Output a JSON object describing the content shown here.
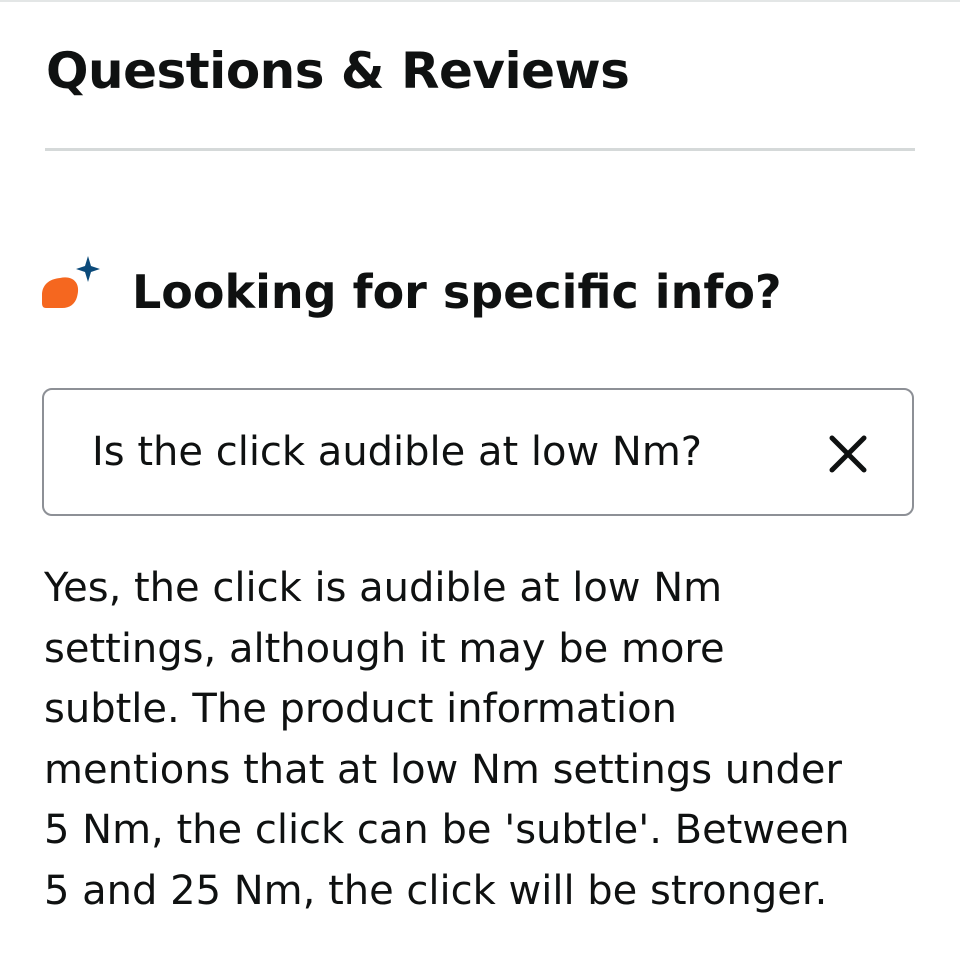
{
  "section": {
    "title": "Questions & Reviews"
  },
  "ai_search": {
    "icon": "ai-sparkle-chat-icon",
    "heading": "Looking for specific info?",
    "query": "Is the click audible at low Nm?",
    "clear_icon": "close-icon",
    "answer": "Yes, the click is audible at low Nm\nsettings, although it may be more\nsubtle. The product information\nmentions that at low Nm settings under\n5 Nm, the click can be 'subtle'. Between\n5 and 25 Nm, the click will be stronger."
  },
  "colors": {
    "text": "#0f1111",
    "icon_orange": "#f5671f",
    "icon_blue": "#0b4a7a",
    "divider": "#d5d9d9",
    "input_border": "#8d9096"
  }
}
